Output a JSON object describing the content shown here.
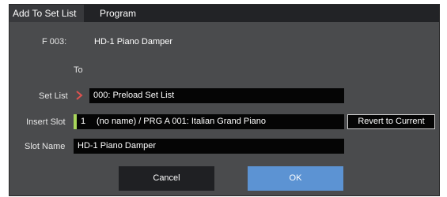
{
  "window": {
    "title": "Add To Set List",
    "mode": "Program"
  },
  "source": {
    "label": "F 003:",
    "name": "HD-1 Piano Damper"
  },
  "to_label": "To",
  "set_list": {
    "label": "Set List",
    "value": "000: Preload Set List"
  },
  "insert_slot": {
    "label": "Insert Slot",
    "number": "1",
    "value": "(no name) / PRG A 001: Italian Grand Piano"
  },
  "revert_label": "Revert to Current",
  "slot_name": {
    "label": "Slot Name",
    "value": "HD-1 Piano Damper"
  },
  "buttons": {
    "cancel": "Cancel",
    "ok": "OK"
  },
  "colors": {
    "accent": "#5c93d3",
    "chevron": "#e0524f",
    "slot_marker": "#a8d65a"
  }
}
